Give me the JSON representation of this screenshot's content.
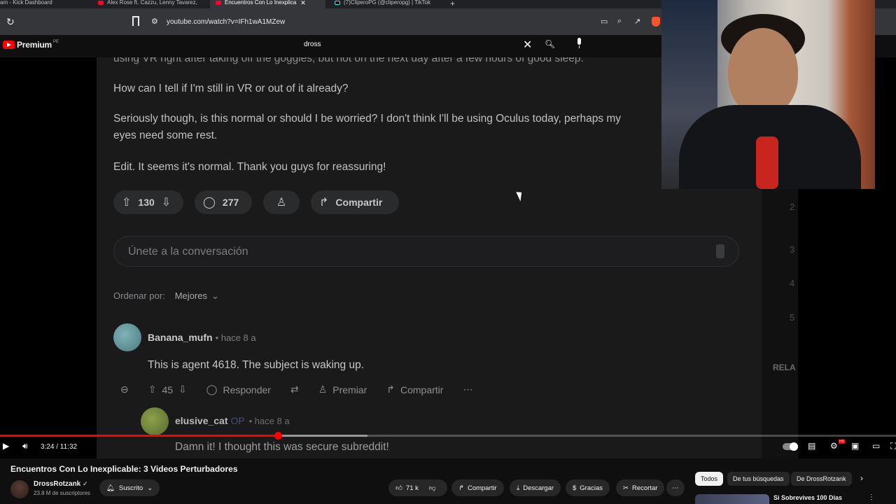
{
  "browser": {
    "tabs": [
      {
        "label": "am - Kick Dashboard"
      },
      {
        "label": "Alex Rose ft. Cazzu, Lenny Tavarez,"
      },
      {
        "label": "Encuentros Con Lo Inexplica"
      },
      {
        "label": "(7)CliperoPG (@cliperopg) | TikTok"
      }
    ],
    "url": "youtube.com/watch?v=IFh1wA1MZew"
  },
  "header": {
    "logo_text": "Premium",
    "country_code": "PE",
    "search_query": "dross"
  },
  "reddit": {
    "post_lines": [
      "using VR right after taking off the goggles, but not on the next day after a few hours of good sleep.",
      "How can I tell if I'm still in VR or out of it already?",
      "Seriously though, is this normal or should I be worried? I don't think I'll be using Oculus today, perhaps my",
      "eyes need some rest.",
      "Edit. It seems it's normal. Thank you guys for reassuring!"
    ],
    "upvotes": "130",
    "comments": "277",
    "share_label": "Compartir",
    "join_placeholder": "Únete a la conversación",
    "sort_label": "Ordenar por:",
    "sort_value": "Mejores",
    "comment1": {
      "user": "Banana_mufn",
      "age": "• hace 8 a",
      "text": "This is agent 4618. The subject is waking up.",
      "votes": "45",
      "reply": "Responder",
      "award": "Premiar",
      "share": "Compartir"
    },
    "comment2": {
      "user": "elusive_cat",
      "op": "OP",
      "age": "• hace 8 a",
      "text": "Damn it! I thought this was secure subreddit!"
    },
    "side_numbers": [
      "2",
      "3",
      "4",
      "5"
    ],
    "side_label": "RELA"
  },
  "player": {
    "time": "3:24 / 11:32",
    "progress_fraction": 0.31,
    "buffered_fraction": 0.41
  },
  "video": {
    "title": "Encuentros Con Lo Inexplicable: 3 Videos Perturbadores",
    "channel": "DrossRotzank",
    "subscribers": "23.8 M de suscriptores",
    "subscribed_label": "Suscrito",
    "likes": "71 k",
    "share": "Compartir",
    "download": "Descargar",
    "thanks": "Gracias",
    "clip": "Recortar"
  },
  "chips": [
    "Todos",
    "De tus búsquedas",
    "De DrossRotzank"
  ],
  "recommendation": {
    "title": "Si Sobrevives 100 Días"
  }
}
